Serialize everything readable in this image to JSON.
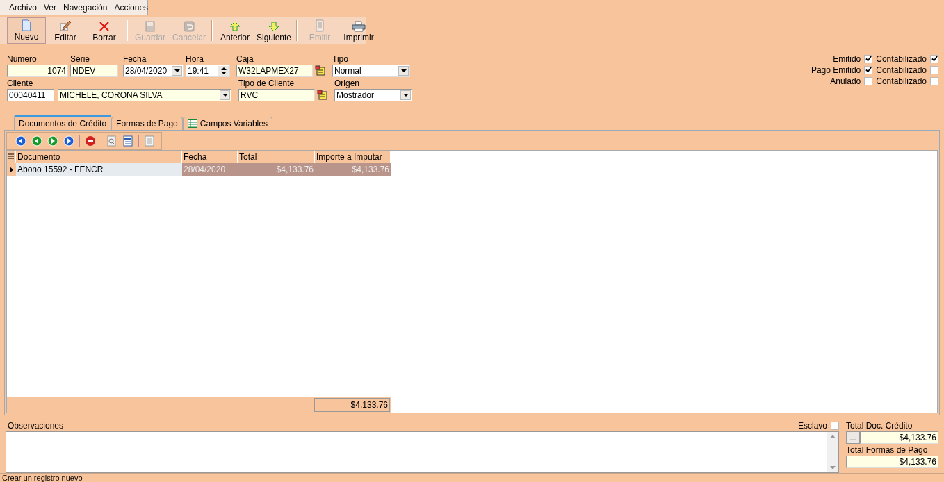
{
  "menu": [
    {
      "label": "Archivo"
    },
    {
      "label": "Ver"
    },
    {
      "label": "Navegación"
    },
    {
      "label": "Acciones"
    }
  ],
  "toolbar": [
    [
      {
        "label": "Nuevo",
        "disabled": false,
        "pressed": true
      },
      {
        "label": "Editar",
        "disabled": false,
        "pressed": false
      },
      {
        "label": "Borrar",
        "disabled": false,
        "pressed": false
      }
    ],
    [
      {
        "label": "Guardar",
        "disabled": true,
        "pressed": false
      },
      {
        "label": "Cancelar",
        "disabled": true,
        "pressed": false
      }
    ],
    [
      {
        "label": "Anterior",
        "disabled": false,
        "pressed": false
      },
      {
        "label": "Siguiente",
        "disabled": false,
        "pressed": false
      }
    ],
    [
      {
        "label": "Emitir",
        "disabled": true,
        "pressed": false
      },
      {
        "label": "Imprimir",
        "disabled": false,
        "pressed": false
      }
    ]
  ],
  "header": {
    "numero": {
      "label": "Número",
      "value": "1074"
    },
    "serie": {
      "label": "Serie",
      "value": "NDEV"
    },
    "fecha": {
      "label": "Fecha",
      "value": "28/04/2020"
    },
    "hora": {
      "label": "Hora",
      "value": "19:41"
    },
    "caja": {
      "label": "Caja",
      "value": "W32LAPMEX27"
    },
    "tipo": {
      "label": "Tipo",
      "value": "Normal"
    },
    "cliente": {
      "label": "Cliente",
      "code": "00040411",
      "name": "MICHELE, CORONA SILVA"
    },
    "tipo_cliente": {
      "label": "Tipo de Cliente",
      "value": "RVC"
    },
    "origen": {
      "label": "Origen",
      "value": "Mostrador"
    }
  },
  "flags": [
    {
      "label": "Emitido",
      "checked": true,
      "accounted_label": "Contabilizado",
      "accounted": true
    },
    {
      "label": "Pago Emitido",
      "checked": true,
      "accounted_label": "Contabilizado",
      "accounted": false
    },
    {
      "label": "Anulado",
      "checked": false,
      "accounted_label": "Contabilizado",
      "accounted": false
    }
  ],
  "tabs": [
    {
      "label": "Documentos de Crédito",
      "selected": true,
      "icon": false
    },
    {
      "label": "Formas de Pago",
      "selected": false,
      "icon": false
    },
    {
      "label": "Campos Variables",
      "selected": false,
      "icon": true
    }
  ],
  "grid": {
    "columns": [
      "Documento",
      "Fecha",
      "Total",
      "Importe a Imputar"
    ],
    "rows": [
      {
        "documento": "Abono 15592 - FENCR",
        "fecha": "28/04/2020",
        "total": "$4,133.76",
        "importe": "$4,133.76",
        "selected": true
      }
    ],
    "footer_total": "$4,133.76"
  },
  "observaciones": {
    "label": "Observaciones"
  },
  "esclavo": {
    "label": "Esclavo",
    "checked": false
  },
  "totals": [
    {
      "label": "Total Doc. Crédito",
      "value": "$4,133.76",
      "button": "..."
    },
    {
      "label": "Total Formas de Pago",
      "value": "$4,133.76"
    }
  ],
  "status": "Crear un registro nuevo"
}
